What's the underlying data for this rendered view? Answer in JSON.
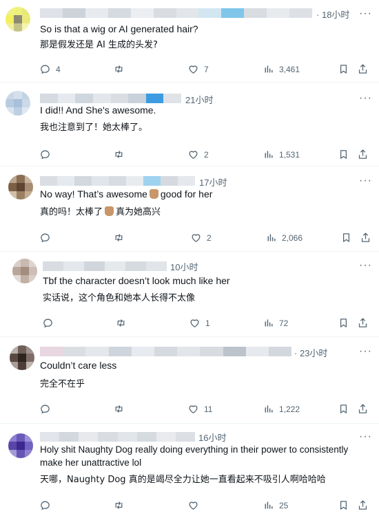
{
  "posts": [
    {
      "time": "18小时",
      "text_en": "So is that a wig or AI generated hair?",
      "text_zh": "那是假发还是 AI 生成的头发?",
      "replies": "4",
      "reposts": "",
      "likes": "7",
      "views": "3,461"
    },
    {
      "time": "21小时",
      "text_en": "I did!! And She's awesome.",
      "text_zh": "我也注意到了！她太棒了。",
      "replies": "",
      "reposts": "",
      "likes": "2",
      "views": "1,531"
    },
    {
      "time": "17小时",
      "text_en_a": "No way! That’s awesome",
      "text_en_b": "good for her",
      "text_zh_a": "真的吗！太棒了",
      "text_zh_b": "真为她高兴",
      "replies": "",
      "reposts": "",
      "likes": "2",
      "views": "2,066"
    },
    {
      "time": "10小时",
      "text_en": "Tbf the character doesn’t look much like her",
      "text_zh": "实话说，这个角色和她本人长得不太像",
      "replies": "",
      "reposts": "",
      "likes": "1",
      "views": "72"
    },
    {
      "time": "23小时",
      "text_en": "Couldn’t care less",
      "text_zh": "完全不在乎",
      "replies": "",
      "reposts": "",
      "likes": "11",
      "views": "1,222"
    },
    {
      "time": "16小时",
      "text_en_1": "Holy shit Naughty Dog really doing everything in their power to consistently",
      "text_en_2": "make her unattractive lol",
      "text_zh": "天哪，Naughty Dog 真的是竭尽全力让她一直看起来不吸引人啊哈哈哈",
      "replies": "",
      "reposts": "",
      "likes": "",
      "views": "25"
    }
  ],
  "time_separator": "·",
  "icons": {
    "more": "more-icon",
    "reply": "reply-icon",
    "repost": "repost-icon",
    "like": "like-icon",
    "views": "views-icon",
    "bookmark": "bookmark-icon",
    "share": "share-icon",
    "emoji": "raised-hand-emoji"
  }
}
